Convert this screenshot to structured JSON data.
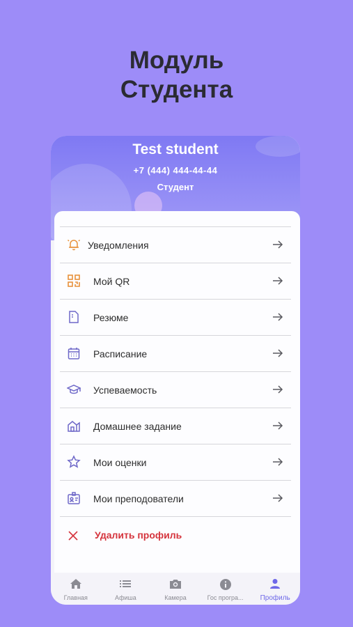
{
  "promo": {
    "line1": "Модуль",
    "line2": "Студента"
  },
  "profile": {
    "name": "Test student",
    "phone": "+7 (444) 444-44-44",
    "role": "Студент"
  },
  "menu": {
    "items": [
      {
        "label": "Уведомления",
        "icon": "bell-icon"
      },
      {
        "label": "Мой QR",
        "icon": "qr-code-icon"
      },
      {
        "label": "Резюме",
        "icon": "document-icon"
      },
      {
        "label": "Расписание",
        "icon": "calendar-icon"
      },
      {
        "label": "Успеваемость",
        "icon": "graduation-cap-icon"
      },
      {
        "label": "Домашнее задание",
        "icon": "homework-icon"
      },
      {
        "label": "Мои оценки",
        "icon": "star-icon"
      },
      {
        "label": "Мои преподователи",
        "icon": "id-badge-icon"
      }
    ],
    "delete_label": "Удалить профиль"
  },
  "tabs": [
    {
      "label": "Главная",
      "icon": "home-icon"
    },
    {
      "label": "Афиша",
      "icon": "list-icon"
    },
    {
      "label": "Камера",
      "icon": "camera-icon"
    },
    {
      "label": "Гос програ...",
      "icon": "info-icon"
    },
    {
      "label": "Профиль",
      "icon": "person-icon",
      "active": true
    }
  ],
  "colors": {
    "background": "#9d8cf8",
    "accent": "#6e68e8",
    "orange_icon": "#e8913a",
    "purple_icon": "#6e68c8",
    "danger": "#d5343d"
  }
}
